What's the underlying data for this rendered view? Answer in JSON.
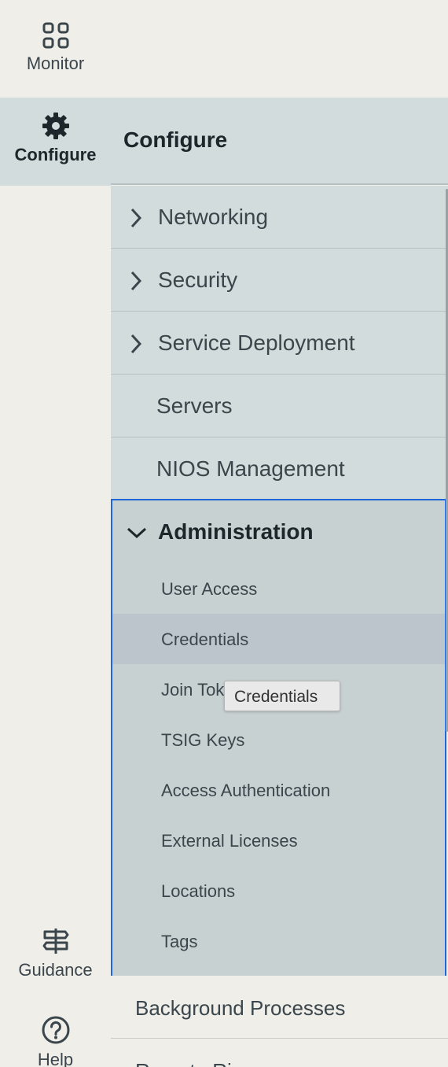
{
  "rail": {
    "monitor_label": "Monitor",
    "configure_label": "Configure",
    "guidance_label": "Guidance",
    "help_label": "Help"
  },
  "panel": {
    "title": "Configure"
  },
  "menu": {
    "items": [
      {
        "label": "Networking",
        "expandable": true
      },
      {
        "label": "Security",
        "expandable": true
      },
      {
        "label": "Service Deployment",
        "expandable": true
      },
      {
        "label": "Servers",
        "expandable": false
      },
      {
        "label": "NIOS Management",
        "expandable": false
      }
    ],
    "administration": {
      "label": "Administration",
      "sub_items": [
        "User Access",
        "Credentials",
        "Join Tok",
        "TSIG Keys",
        "Access Authentication",
        "External Licenses",
        "Locations",
        "Tags"
      ]
    },
    "background_processes": "Background Processes",
    "partial_item": "Remote Ri"
  },
  "tooltip": {
    "text": "Credentials"
  },
  "colors": {
    "active_bg": "#d3dcdc",
    "admin_bg": "#c8d1d2",
    "focus_border": "#1f66d8",
    "selected_bg": "#bcc5cb"
  }
}
